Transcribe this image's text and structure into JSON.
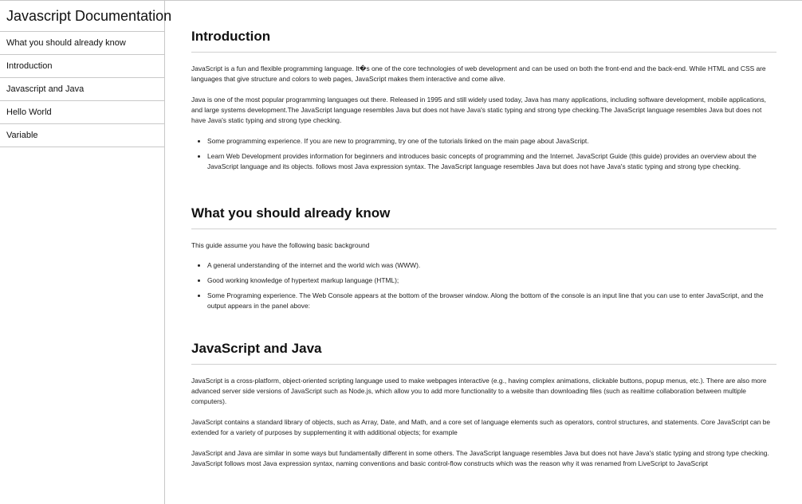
{
  "sidebar": {
    "header": "Javascript Documentation",
    "items": [
      {
        "label": "What you should already know"
      },
      {
        "label": "Introduction"
      },
      {
        "label": "Javascript and Java"
      },
      {
        "label": "Hello World"
      },
      {
        "label": "Variable"
      }
    ]
  },
  "main": {
    "sections": [
      {
        "title": "Introduction",
        "paragraphs": [
          "JavaScript is a fun and flexible programming language. It�s one of the core technologies of web development and can be used on both the front-end and the back-end. While HTML and CSS are languages that give structure and colors to web pages, JavaScript makes them interactive and come alive.",
          "Java is one of the most popular programming languages out there. Released in 1995 and still widely used today, Java has many applications, including software development, mobile applications, and large systems development.The JavaScript language resembles Java but does not have Java's static typing and strong type checking.The JavaScript language resembles Java but does not have Java's static typing and strong type checking."
        ],
        "list": [
          "Some programming experience. If you are new to programming, try one of the tutorials linked on the main page about JavaScript.",
          "Learn Web Development provides information for beginners and introduces basic concepts of programming and the Internet. JavaScript Guide (this guide) provides an overview about the JavaScript language and its objects. follows most Java expression syntax. The JavaScript language resembles Java but does not have Java's static typing and strong type checking."
        ]
      },
      {
        "title": "What you should already know",
        "paragraphs": [
          "This guide assume you have the following basic background"
        ],
        "list": [
          "A general understanding of the internet and the world wich was (WWW).",
          "Good working knowledge of hypertext markup language (HTML);",
          "Some Programing experience. The Web Console appears at the bottom of the browser window. Along the bottom of the console is an input line that you can use to enter JavaScript, and the output appears in the panel above:"
        ]
      },
      {
        "title": "JavaScript and Java",
        "paragraphs": [
          "JavaScript is a cross-platform, object-oriented scripting language used to make webpages interactive (e.g., having complex animations, clickable buttons, popup menus, etc.). There are also more advanced server side versions of JavaScript such as Node.js, which allow you to add more functionality to a website than downloading files (such as realtime collaboration between multiple computers).",
          "JavaScript contains a standard library of objects, such as Array, Date, and Math, and a core set of language elements such as operators, control structures, and statements. Core JavaScript can be extended for a variety of purposes by supplementing it with additional objects; for example",
          "JavaScript and Java are similar in some ways but fundamentally different in some others. The JavaScript language resembles Java but does not have Java's static typing and strong type checking. JavaScript follows most Java expression syntax, naming conventions and basic control-flow constructs which was the reason why it was renamed from LiveScript to JavaScript"
        ],
        "list": []
      }
    ]
  }
}
